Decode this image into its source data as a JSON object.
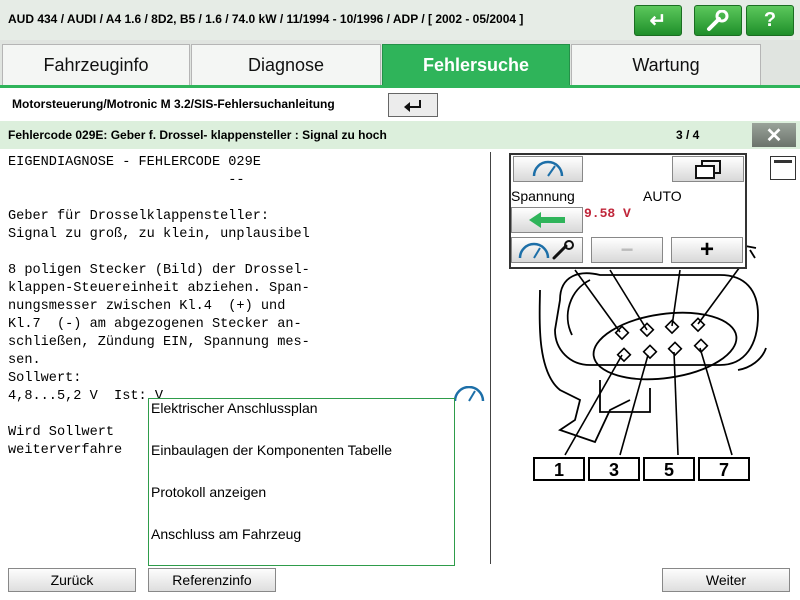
{
  "header": {
    "vehicle": "AUD 434 / AUDI / A4 1.6 / 8D2, B5 / 1.6 / 74.0 kW / 11/1994 - 10/1996 / ADP /  [ 2002 - 05/2004 ]",
    "buttons": [
      {
        "icon": "return-icon",
        "glyph": "↵"
      },
      {
        "icon": "wrench-icon",
        "glyph": "🔧"
      },
      {
        "icon": "help-icon",
        "glyph": "?"
      }
    ],
    "accent": "#2fb45a"
  },
  "tabs": [
    {
      "label": "Fahrzeuginfo",
      "active": false
    },
    {
      "label": "Diagnose",
      "active": false
    },
    {
      "label": "Fehlersuche",
      "active": true
    },
    {
      "label": "Wartung",
      "active": false
    }
  ],
  "breadcrumb": "Motorsteuerung/Motronic M 3.2/SIS-Fehlersuchanleitung",
  "fault": {
    "title": "Fehlercode 029E: Geber f. Drossel- klappensteller  : Signal zu hoch",
    "page": "3 / 4"
  },
  "content_lines": [
    "EIGENDIAGNOSE - FEHLERCODE 029E",
    "                           --",
    "",
    "Geber für Drosselklappensteller:",
    "Signal zu groß, zu klein, unplausibel",
    "",
    "8 poligen Stecker (Bild) der Drossel-",
    "klappen-Steuereinheit abziehen. Span-",
    "nungsmesser zwischen Kl.4  (+) und",
    "Kl.7  (-) am abgezogenen Stecker an-",
    "schließen, Zündung EIN, Spannung mes-",
    "sen.",
    "Sollwert:",
    "4,8...5,2 V  Ist: V",
    "",
    "Wird Sollwert",
    "weiterverfahre"
  ],
  "meter": {
    "label": "Spannung",
    "mode": "AUTO",
    "value": "9.58 V",
    "minus": "−",
    "plus": "+",
    "value_color": "#c0263a"
  },
  "diagram": {
    "pin_labels": [
      "1",
      "3",
      "5",
      "7"
    ]
  },
  "menu": [
    "Elektrischer Anschlussplan",
    "Einbaulagen der Komponenten Tabelle",
    "Protokoll anzeigen",
    "Anschluss am Fahrzeug"
  ],
  "footer": {
    "back": "Zurück",
    "reference": "Referenzinfo",
    "next": "Weiter"
  }
}
